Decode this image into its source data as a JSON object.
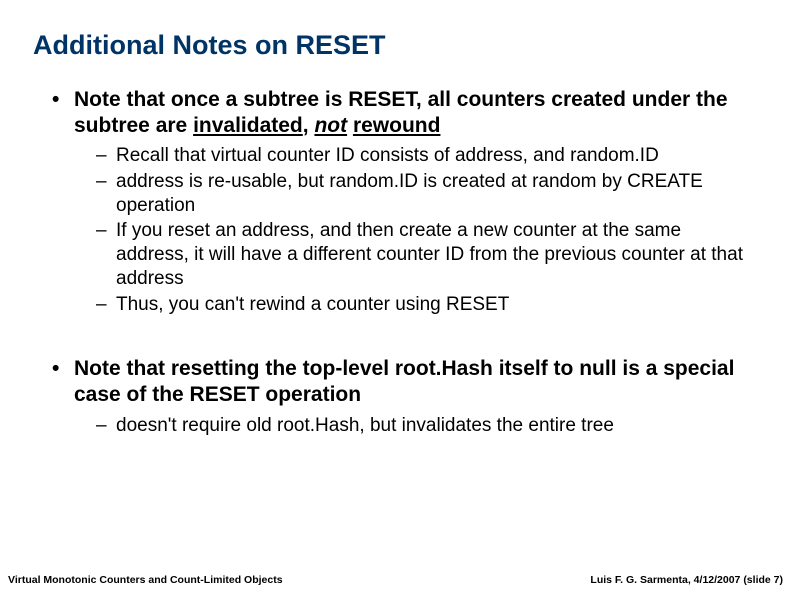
{
  "title": "Additional Notes on RESET",
  "bullets": [
    {
      "text_pre": "Note that once a subtree is RESET, all counters created under the subtree are ",
      "u1": "invalidated",
      "mid": ", ",
      "iu": "not",
      "sp": " ",
      "u2": "rewound",
      "subs": [
        "Recall that virtual counter ID consists of address, and random.ID",
        "address is re-usable, but random.ID is created at random by CREATE operation",
        "If you reset an address, and then create a new counter at the same address, it will have a different counter ID from the previous counter at that address",
        "Thus, you can't rewind a counter using RESET"
      ]
    },
    {
      "text": "Note that resetting the top-level root.Hash itself to null is a special case of the RESET operation",
      "subs": [
        "doesn't require old root.Hash, but invalidates the entire tree"
      ]
    }
  ],
  "footer": {
    "left": "Virtual Monotonic Counters and Count-Limited Objects",
    "right": "Luis F. G. Sarmenta, 4/12/2007 (slide 7)"
  }
}
